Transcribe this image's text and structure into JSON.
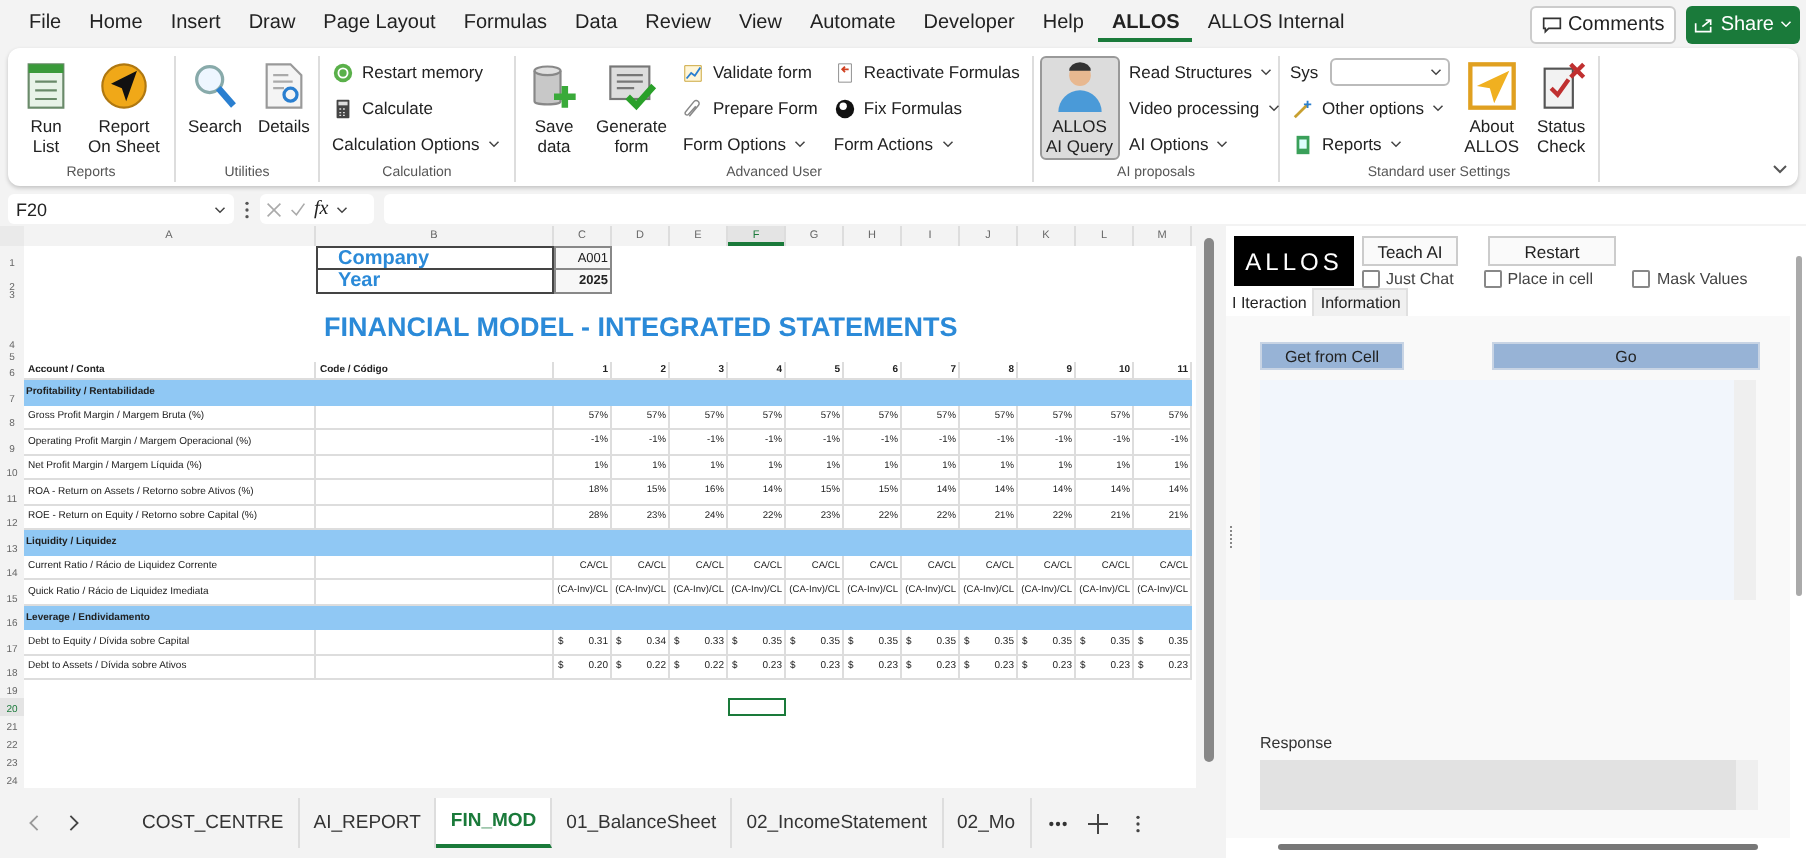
{
  "menu": {
    "tabs": [
      {
        "label": "File",
        "selected": false
      },
      {
        "label": "Home",
        "selected": false
      },
      {
        "label": "Insert",
        "selected": false
      },
      {
        "label": "Draw",
        "selected": false
      },
      {
        "label": "Page Layout",
        "selected": false
      },
      {
        "label": "Formulas",
        "selected": false
      },
      {
        "label": "Data",
        "selected": false
      },
      {
        "label": "Review",
        "selected": false
      },
      {
        "label": "View",
        "selected": false
      },
      {
        "label": "Automate",
        "selected": false
      },
      {
        "label": "Developer",
        "selected": false
      },
      {
        "label": "Help",
        "selected": false
      },
      {
        "label": "ALLOS",
        "selected": true
      },
      {
        "label": "ALLOS Internal",
        "selected": false
      }
    ],
    "comments_button": "Comments",
    "share_button": "Share"
  },
  "ribbon": {
    "groups": [
      {
        "title": "Reports",
        "items": [
          {
            "kind": "large",
            "label": "Run\nList",
            "dropdown": false,
            "pressed": false
          },
          {
            "kind": "large",
            "label": "Report\nOn Sheet",
            "dropdown": false,
            "pressed": false
          }
        ]
      },
      {
        "title": "Utilities",
        "items": [
          {
            "kind": "large",
            "label": "Search",
            "dropdown": false,
            "pressed": false
          },
          {
            "kind": "large",
            "label": "Details",
            "dropdown": false,
            "pressed": false
          }
        ]
      },
      {
        "title": "Calculation",
        "items": [
          {
            "kind": "small",
            "label": "Restart memory",
            "dropdown": false,
            "pressed": false
          },
          {
            "kind": "small",
            "label": "Calculate",
            "dropdown": false,
            "pressed": false
          },
          {
            "kind": "small",
            "label": "Calculation Options",
            "dropdown": true,
            "pressed": false
          }
        ]
      },
      {
        "title": "Advanced User",
        "items": [
          {
            "kind": "large",
            "label": "Save\ndata",
            "dropdown": false,
            "pressed": false
          },
          {
            "kind": "large",
            "label": "Generate\nform",
            "dropdown": false,
            "pressed": false
          },
          {
            "kind": "small",
            "label": "Validate form",
            "dropdown": false,
            "pressed": false
          },
          {
            "kind": "small",
            "label": "Prepare Form",
            "dropdown": false,
            "pressed": false
          },
          {
            "kind": "small",
            "label": "Form Options",
            "dropdown": true,
            "pressed": false
          },
          {
            "kind": "small",
            "label": "Reactivate Formulas",
            "dropdown": false,
            "pressed": false
          },
          {
            "kind": "small",
            "label": "Fix Formulas",
            "dropdown": false,
            "pressed": false
          },
          {
            "kind": "small",
            "label": "Form Actions",
            "dropdown": true,
            "pressed": false
          }
        ]
      },
      {
        "title": "AI proposals",
        "items": [
          {
            "kind": "large",
            "label": "ALLOS\nAI Query",
            "dropdown": false,
            "pressed": true
          },
          {
            "kind": "small",
            "label": "Read Structures",
            "dropdown": true,
            "pressed": false
          },
          {
            "kind": "small",
            "label": "Video processing",
            "dropdown": true,
            "pressed": false
          },
          {
            "kind": "small",
            "label": "AI Options",
            "dropdown": true,
            "pressed": false
          }
        ]
      },
      {
        "title": "Standard user Settings",
        "items": [
          {
            "kind": "combo",
            "label": "Sys",
            "dropdown": true,
            "pressed": false
          },
          {
            "kind": "small",
            "label": "Other options",
            "dropdown": true,
            "pressed": false
          },
          {
            "kind": "small",
            "label": "Reports",
            "dropdown": true,
            "pressed": false
          },
          {
            "kind": "large",
            "label": "About\nALLOS",
            "dropdown": false,
            "pressed": false
          },
          {
            "kind": "large",
            "label": "Status\nCheck",
            "dropdown": false,
            "pressed": false
          }
        ]
      }
    ]
  },
  "formula_bar": {
    "name_box": "F20",
    "function_label": "fx"
  },
  "sheet": {
    "columns": [
      {
        "label": "A",
        "selected": false
      },
      {
        "label": "B",
        "selected": false
      },
      {
        "label": "C",
        "selected": false
      },
      {
        "label": "D",
        "selected": false
      },
      {
        "label": "E",
        "selected": false
      },
      {
        "label": "F",
        "selected": true
      },
      {
        "label": "G",
        "selected": false
      },
      {
        "label": "H",
        "selected": false
      },
      {
        "label": "I",
        "selected": false
      },
      {
        "label": "J",
        "selected": false
      },
      {
        "label": "K",
        "selected": false
      },
      {
        "label": "L",
        "selected": false
      },
      {
        "label": "M",
        "selected": false
      }
    ],
    "rows": [
      {
        "kind": "field",
        "number": "1",
        "selected": false,
        "label": "Company",
        "value": "A001"
      },
      {
        "kind": "field",
        "number": "2",
        "selected": false,
        "label": "Year",
        "value": "2025"
      },
      {
        "kind": "spacer",
        "number": "3",
        "selected": false
      },
      {
        "kind": "title",
        "number": "4",
        "selected": false,
        "label": "FINANCIAL MODEL - INTEGRATED STATEMENTS"
      },
      {
        "kind": "spacer",
        "number": "5",
        "selected": false
      },
      {
        "kind": "header",
        "number": "6",
        "selected": false,
        "label": "Account / Conta",
        "code": "Code / Código",
        "cells": [
          "1",
          "2",
          "3",
          "4",
          "5",
          "6",
          "7",
          "8",
          "9",
          "10",
          "11"
        ]
      },
      {
        "kind": "section",
        "number": "7",
        "selected": false,
        "label": "Profitability / Rentabilidade"
      },
      {
        "kind": "data",
        "number": "8",
        "selected": false,
        "label": "Gross Profit Margin / Margem Bruta (%)",
        "cells": [
          "57%",
          "57%",
          "57%",
          "57%",
          "57%",
          "57%",
          "57%",
          "57%",
          "57%",
          "57%",
          "57%"
        ]
      },
      {
        "kind": "data",
        "number": "9",
        "selected": false,
        "label": "Operating Profit Margin / Margem Operacional (%)",
        "cells": [
          "-1%",
          "-1%",
          "-1%",
          "-1%",
          "-1%",
          "-1%",
          "-1%",
          "-1%",
          "-1%",
          "-1%",
          "-1%"
        ]
      },
      {
        "kind": "data",
        "number": "10",
        "selected": false,
        "label": "Net Profit Margin / Margem Líquida (%)",
        "cells": [
          "1%",
          "1%",
          "1%",
          "1%",
          "1%",
          "1%",
          "1%",
          "1%",
          "1%",
          "1%",
          "1%"
        ]
      },
      {
        "kind": "data",
        "number": "11",
        "selected": false,
        "label": "ROA - Return on Assets / Retorno sobre Ativos (%)",
        "cells": [
          "18%",
          "15%",
          "16%",
          "14%",
          "15%",
          "15%",
          "14%",
          "14%",
          "14%",
          "14%",
          "14%"
        ]
      },
      {
        "kind": "data",
        "number": "12",
        "selected": false,
        "label": "ROE - Return on Equity / Retorno sobre Capital (%)",
        "cells": [
          "28%",
          "23%",
          "24%",
          "22%",
          "23%",
          "22%",
          "22%",
          "21%",
          "22%",
          "21%",
          "21%"
        ]
      },
      {
        "kind": "section",
        "number": "13",
        "selected": false,
        "label": "Liquidity / Liquidez"
      },
      {
        "kind": "data",
        "number": "14",
        "selected": false,
        "label": "Current Ratio / Rácio de Liquidez Corrente",
        "cells": [
          "CA/CL",
          "CA/CL",
          "CA/CL",
          "CA/CL",
          "CA/CL",
          "CA/CL",
          "CA/CL",
          "CA/CL",
          "CA/CL",
          "CA/CL",
          "CA/CL"
        ]
      },
      {
        "kind": "data",
        "number": "15",
        "selected": false,
        "label": "Quick Ratio / Rácio de Liquidez Imediata",
        "cells": [
          "(CA-Inv)/CL",
          "(CA-Inv)/CL",
          "(CA-Inv)/CL",
          "(CA-Inv)/CL",
          "(CA-Inv)/CL",
          "(CA-Inv)/CL",
          "(CA-Inv)/CL",
          "(CA-Inv)/CL",
          "(CA-Inv)/CL",
          "(CA-Inv)/CL",
          "(CA-Inv)/CL"
        ]
      },
      {
        "kind": "section",
        "number": "16",
        "selected": false,
        "label": "Leverage / Endividamento"
      },
      {
        "kind": "currency",
        "number": "17",
        "selected": false,
        "label": "Debt to Equity / Dívida sobre Capital",
        "cells": [
          {
            "symbol": "$",
            "value": "0.31"
          },
          {
            "symbol": "$",
            "value": "0.34"
          },
          {
            "symbol": "$",
            "value": "0.33"
          },
          {
            "symbol": "$",
            "value": "0.35"
          },
          {
            "symbol": "$",
            "value": "0.35"
          },
          {
            "symbol": "$",
            "value": "0.35"
          },
          {
            "symbol": "$",
            "value": "0.35"
          },
          {
            "symbol": "$",
            "value": "0.35"
          },
          {
            "symbol": "$",
            "value": "0.35"
          },
          {
            "symbol": "$",
            "value": "0.35"
          },
          {
            "symbol": "$",
            "value": "0.35"
          }
        ]
      },
      {
        "kind": "currency",
        "number": "18",
        "selected": false,
        "label": "Debt to Assets / Dívida sobre Ativos",
        "cells": [
          {
            "symbol": "$",
            "value": "0.20"
          },
          {
            "symbol": "$",
            "value": "0.22"
          },
          {
            "symbol": "$",
            "value": "0.22"
          },
          {
            "symbol": "$",
            "value": "0.23"
          },
          {
            "symbol": "$",
            "value": "0.23"
          },
          {
            "symbol": "$",
            "value": "0.23"
          },
          {
            "symbol": "$",
            "value": "0.23"
          },
          {
            "symbol": "$",
            "value": "0.23"
          },
          {
            "symbol": "$",
            "value": "0.23"
          },
          {
            "symbol": "$",
            "value": "0.23"
          },
          {
            "symbol": "$",
            "value": "0.23"
          }
        ]
      },
      {
        "kind": "empty",
        "number": "19",
        "selected": false
      },
      {
        "kind": "empty",
        "number": "20",
        "selected": true
      },
      {
        "kind": "empty",
        "number": "21",
        "selected": false
      },
      {
        "kind": "empty",
        "number": "22",
        "selected": false
      },
      {
        "kind": "empty",
        "number": "23",
        "selected": false
      },
      {
        "kind": "empty",
        "number": "24",
        "selected": false
      }
    ]
  },
  "sheet_tabs": [
    {
      "label": "COST_CENTRE",
      "selected": false
    },
    {
      "label": "AI_REPORT",
      "selected": false
    },
    {
      "label": "FIN_MOD",
      "selected": true
    },
    {
      "label": "01_BalanceSheet",
      "selected": false
    },
    {
      "label": "02_IncomeStatement",
      "selected": false
    },
    {
      "label": "02_Mo",
      "selected": false
    }
  ],
  "pane": {
    "logo": "ALLOS",
    "buttons": [
      "Teach AI",
      "Restart"
    ],
    "checkboxes": [
      {
        "label": "Just Chat",
        "checked": false
      },
      {
        "label": "Place in cell",
        "checked": false
      },
      {
        "label": "Mask Values",
        "checked": false
      }
    ],
    "tabs": [
      {
        "label": "I Iteraction",
        "selected": true
      },
      {
        "label": "Information",
        "selected": false
      }
    ],
    "get_button": "Get from Cell",
    "go_button": "Go",
    "response_label": "Response"
  }
}
